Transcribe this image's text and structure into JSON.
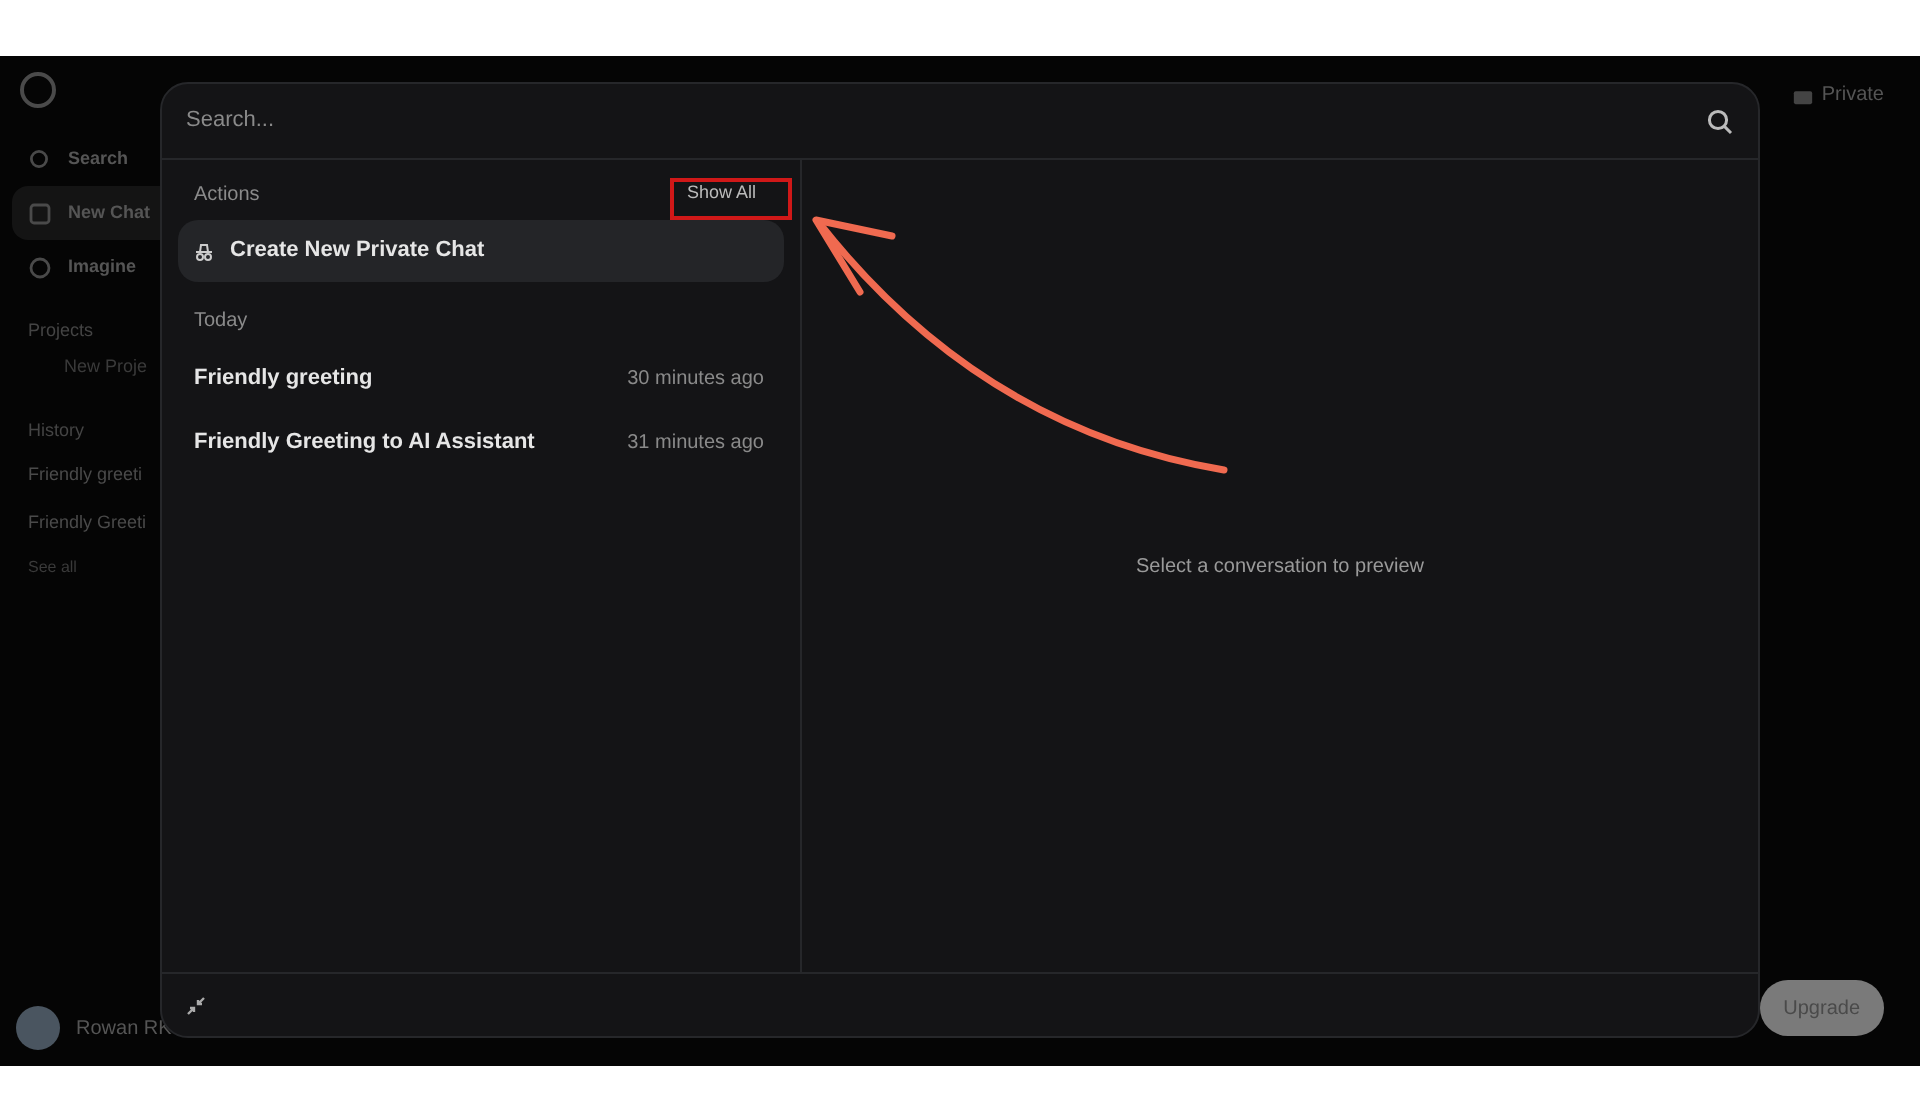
{
  "sidebar": {
    "items": [
      {
        "kind": "nav",
        "label": "Search",
        "selected": false
      },
      {
        "kind": "nav",
        "label": "New Chat",
        "selected": true
      },
      {
        "kind": "nav",
        "label": "Imagine",
        "selected": false
      },
      {
        "kind": "section",
        "label": "Projects"
      },
      {
        "kind": "sub",
        "label": "New Proje"
      },
      {
        "kind": "section",
        "label": "History"
      },
      {
        "kind": "link",
        "label": "Friendly greeti"
      },
      {
        "kind": "link",
        "label": "Friendly Greeti"
      },
      {
        "kind": "more",
        "label": "See all"
      }
    ],
    "user": "Rowan RK"
  },
  "header": {
    "private_label": "Private"
  },
  "upgrade_button": "Upgrade",
  "dialog": {
    "search": {
      "placeholder": "Search..."
    },
    "actions": {
      "heading": "Actions",
      "show_all": "Show All",
      "items": [
        {
          "label": "Create New Private Chat",
          "selected": true
        }
      ]
    },
    "groups": [
      {
        "heading": "Today",
        "items": [
          {
            "title": "Friendly greeting",
            "time": "30 minutes ago"
          },
          {
            "title": "Friendly Greeting to AI Assistant",
            "time": "31 minutes ago"
          }
        ]
      }
    ],
    "preview_message": "Select a conversation to preview"
  }
}
